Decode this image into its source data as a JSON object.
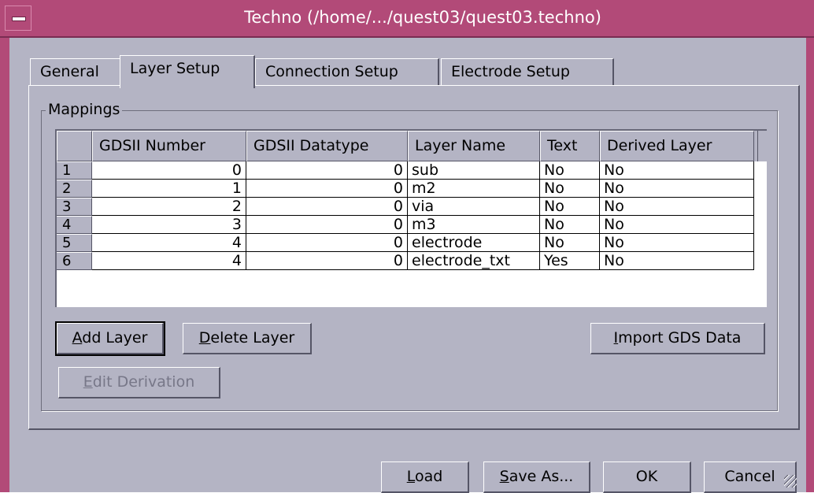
{
  "window": {
    "title": "Techno (/home/.../quest03/quest03.techno)"
  },
  "tabs": [
    {
      "label": "General"
    },
    {
      "label": "Layer Setup"
    },
    {
      "label": "Connection Setup"
    },
    {
      "label": "Electrode Setup"
    }
  ],
  "active_tab": "Layer Setup",
  "mappings": {
    "label": "Mappings",
    "columns": [
      "GDSII Number",
      "GDSII Datatype",
      "Layer Name",
      "Text",
      "Derived Layer"
    ],
    "rows": [
      {
        "index": "1",
        "gdsii_number": "0",
        "gdsii_datatype": "0",
        "layer_name": "sub",
        "text": "No",
        "derived": "No"
      },
      {
        "index": "2",
        "gdsii_number": "1",
        "gdsii_datatype": "0",
        "layer_name": "m2",
        "text": "No",
        "derived": "No"
      },
      {
        "index": "3",
        "gdsii_number": "2",
        "gdsii_datatype": "0",
        "layer_name": "via",
        "text": "No",
        "derived": "No"
      },
      {
        "index": "4",
        "gdsii_number": "3",
        "gdsii_datatype": "0",
        "layer_name": "m3",
        "text": "No",
        "derived": "No"
      },
      {
        "index": "5",
        "gdsii_number": "4",
        "gdsii_datatype": "0",
        "layer_name": "electrode",
        "text": "No",
        "derived": "No"
      },
      {
        "index": "6",
        "gdsii_number": "4",
        "gdsii_datatype": "0",
        "layer_name": "electrode_txt",
        "text": "Yes",
        "derived": "No"
      }
    ]
  },
  "buttons": {
    "add_layer": {
      "mnemonic": "A",
      "rest": "dd Layer"
    },
    "delete_layer": {
      "mnemonic": "D",
      "rest": "elete Layer"
    },
    "import_gds": {
      "mnemonic": "I",
      "rest": "mport GDS Data"
    },
    "edit_derivation": {
      "mnemonic": "E",
      "rest": "dit Derivation"
    },
    "load": {
      "mnemonic": "L",
      "rest": "oad"
    },
    "save_as": {
      "mnemonic": "S",
      "rest": "ave As..."
    },
    "ok": {
      "label": "OK"
    },
    "cancel": {
      "label": "Cancel"
    }
  },
  "colors": {
    "titlebar": "#b24a78",
    "background": "#b4b4c4"
  }
}
